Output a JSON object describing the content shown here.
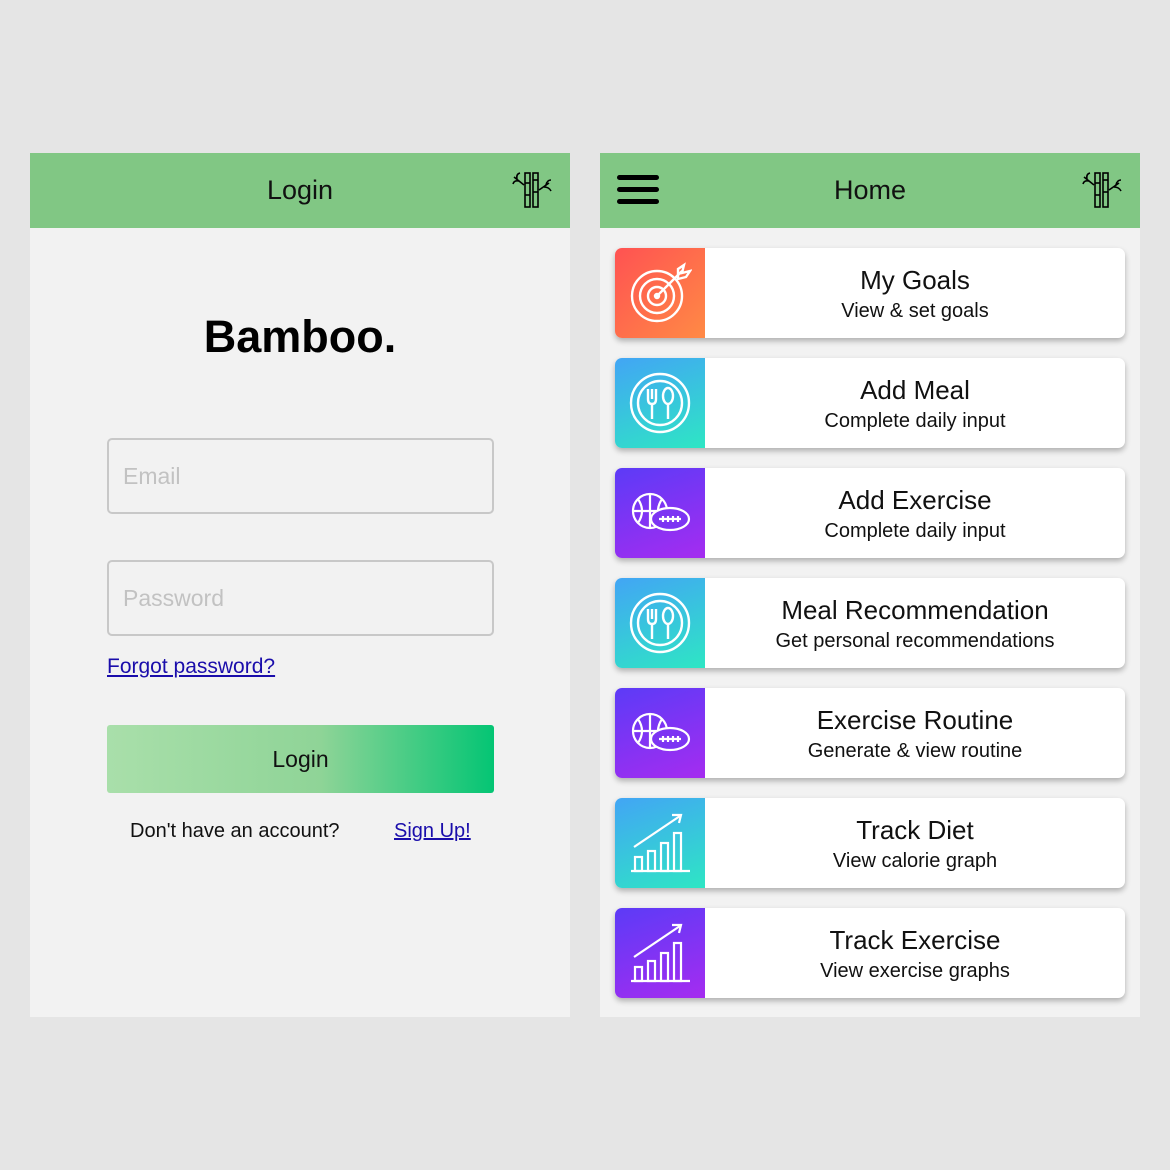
{
  "login": {
    "title": "Login",
    "brand": "Bamboo.",
    "email_placeholder": "Email",
    "password_placeholder": "Password",
    "forgot_link": "Forgot password?",
    "login_button": "Login",
    "signup_prompt": "Don't have an account?",
    "signup_link": "Sign Up!"
  },
  "home": {
    "title": "Home",
    "cards": [
      {
        "title": "My Goals",
        "subtitle": "View & set goals",
        "icon": "target-icon"
      },
      {
        "title": "Add Meal",
        "subtitle": "Complete daily input",
        "icon": "plate-cutlery-icon"
      },
      {
        "title": "Add Exercise",
        "subtitle": "Complete daily input",
        "icon": "sports-balls-icon"
      },
      {
        "title": "Meal Recommendation",
        "subtitle": "Get personal recommendations",
        "icon": "plate-cutlery-icon"
      },
      {
        "title": "Exercise Routine",
        "subtitle": "Generate & view routine",
        "icon": "sports-balls-icon"
      },
      {
        "title": "Track Diet",
        "subtitle": "View calorie graph",
        "icon": "growth-chart-icon"
      },
      {
        "title": "Track Exercise",
        "subtitle": "View exercise graphs",
        "icon": "growth-chart-icon"
      }
    ]
  },
  "colors": {
    "app_bar": "#81c784",
    "screen_bg": "#f2f2f2",
    "page_bg": "#e5e5e5",
    "link": "#1a0dab",
    "login_button_end": "#04c574"
  }
}
